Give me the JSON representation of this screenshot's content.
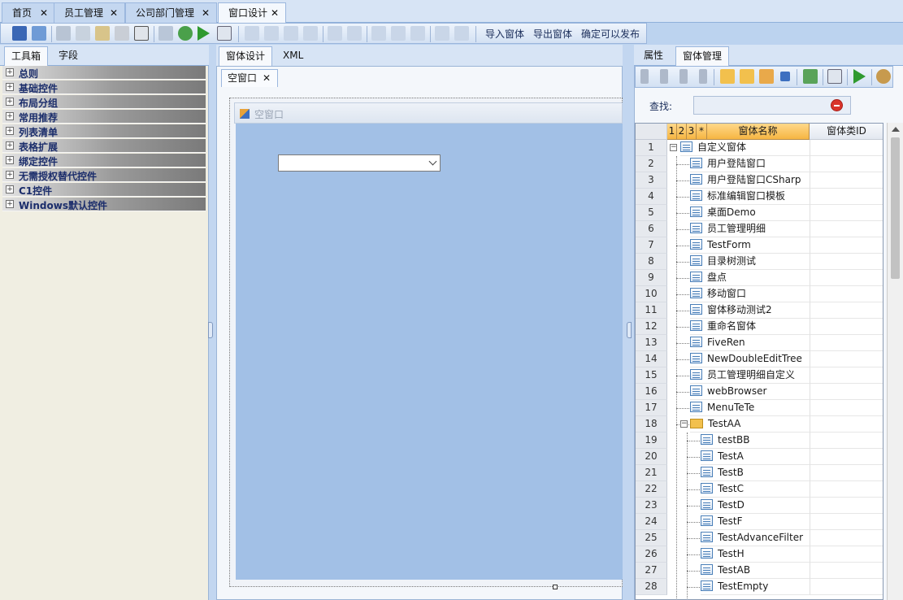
{
  "doc_tabs": [
    {
      "label": "首页",
      "active": false
    },
    {
      "label": "员工管理",
      "active": false
    },
    {
      "label": "公司部门管理",
      "active": false
    },
    {
      "label": "窗口设计",
      "active": true
    }
  ],
  "close_glyph": "✕",
  "toolbar": {
    "import_label": "导入窗体",
    "export_label": "导出窗体",
    "publish_label": "确定可以发布"
  },
  "left_tabs": [
    "工具箱",
    "字段"
  ],
  "toolbox_categories": [
    "总则",
    "基础控件",
    "布局分组",
    "常用推荐",
    "列表清单",
    "表格扩展",
    "绑定控件",
    "无需授权替代控件",
    "C1控件",
    "Windows默认控件"
  ],
  "mid_tabs": [
    "窗体设计",
    "XML"
  ],
  "form_tab": "空窗口",
  "form_title": "空窗口",
  "right_tabs": [
    "属性",
    "窗体管理"
  ],
  "search_label": "查找:",
  "grid": {
    "headers": [
      "1",
      "2",
      "3",
      "*",
      "窗体名称",
      "窗体类ID"
    ],
    "rows": [
      {
        "num": "1",
        "name": "自定义窗体",
        "level": 0,
        "type": "root"
      },
      {
        "num": "2",
        "name": "用户登陆窗口",
        "level": 1,
        "type": "form"
      },
      {
        "num": "3",
        "name": "用户登陆窗口CSharp",
        "level": 1,
        "type": "form"
      },
      {
        "num": "4",
        "name": "标准编辑窗口模板",
        "level": 1,
        "type": "form"
      },
      {
        "num": "5",
        "name": "桌面Demo",
        "level": 1,
        "type": "form"
      },
      {
        "num": "6",
        "name": "员工管理明细",
        "level": 1,
        "type": "form"
      },
      {
        "num": "7",
        "name": "TestForm",
        "level": 1,
        "type": "form"
      },
      {
        "num": "8",
        "name": "目录树测试",
        "level": 1,
        "type": "form"
      },
      {
        "num": "9",
        "name": "盘点",
        "level": 1,
        "type": "form"
      },
      {
        "num": "10",
        "name": "移动窗口",
        "level": 1,
        "type": "form"
      },
      {
        "num": "11",
        "name": "窗体移动测试2",
        "level": 1,
        "type": "form"
      },
      {
        "num": "12",
        "name": "重命名窗体",
        "level": 1,
        "type": "form"
      },
      {
        "num": "13",
        "name": "FiveRen",
        "level": 1,
        "type": "form"
      },
      {
        "num": "14",
        "name": "NewDoubleEditTree",
        "level": 1,
        "type": "form"
      },
      {
        "num": "15",
        "name": "员工管理明细自定义",
        "level": 1,
        "type": "form"
      },
      {
        "num": "16",
        "name": "webBrowser",
        "level": 1,
        "type": "form"
      },
      {
        "num": "17",
        "name": "MenuTeTe",
        "level": 1,
        "type": "form"
      },
      {
        "num": "18",
        "name": "TestAA",
        "level": 1,
        "type": "folder"
      },
      {
        "num": "19",
        "name": "testBB",
        "level": 2,
        "type": "form"
      },
      {
        "num": "20",
        "name": "TestA",
        "level": 2,
        "type": "form"
      },
      {
        "num": "21",
        "name": "TestB",
        "level": 2,
        "type": "form"
      },
      {
        "num": "22",
        "name": "TestC",
        "level": 2,
        "type": "form"
      },
      {
        "num": "23",
        "name": "TestD",
        "level": 2,
        "type": "form"
      },
      {
        "num": "24",
        "name": "TestF",
        "level": 2,
        "type": "form"
      },
      {
        "num": "25",
        "name": "TestAdvanceFilter",
        "level": 2,
        "type": "form"
      },
      {
        "num": "26",
        "name": "TestH",
        "level": 2,
        "type": "form"
      },
      {
        "num": "27",
        "name": "TestAB",
        "level": 2,
        "type": "form"
      },
      {
        "num": "28",
        "name": "TestEmpty",
        "level": 2,
        "type": "form"
      }
    ]
  },
  "colors": {
    "accent": "#f6b643",
    "form_bg": "#a2c0e6",
    "chrome": "#d7e4f5"
  }
}
